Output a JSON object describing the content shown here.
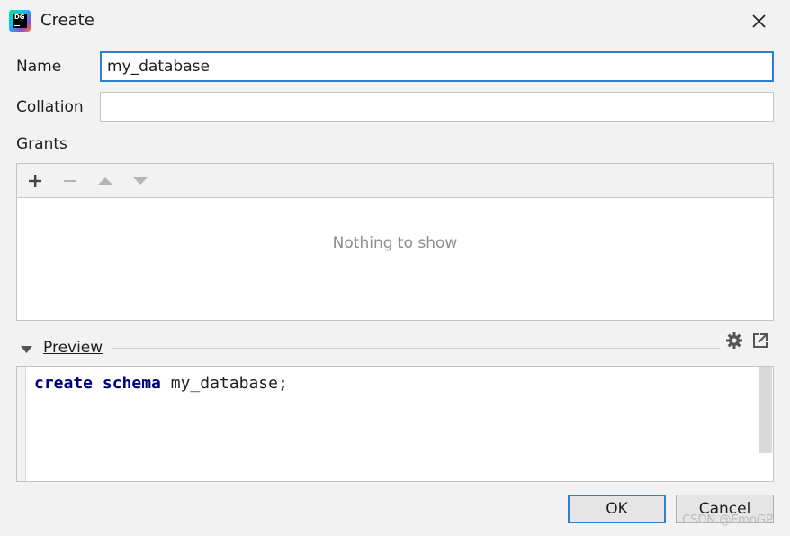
{
  "window": {
    "title": "Create",
    "app_icon_text": "DG"
  },
  "form": {
    "name_label": "Name",
    "name_value": "my_database",
    "collation_label": "Collation",
    "collation_value": ""
  },
  "grants": {
    "label": "Grants",
    "toolbar": [
      "add-icon",
      "remove-icon",
      "move-up-icon",
      "move-down-icon"
    ],
    "empty_text": "Nothing to show"
  },
  "preview": {
    "label": "Preview",
    "code_keyword1": "create",
    "code_keyword2": "schema",
    "code_rest": " my_database;"
  },
  "buttons": {
    "ok": "OK",
    "cancel": "Cancel"
  },
  "watermark": "CSDN @EmoGP",
  "colors": {
    "accent": "#2f7fd1",
    "keyword": "#000080",
    "placeholder_text": "#8c8c8c"
  }
}
